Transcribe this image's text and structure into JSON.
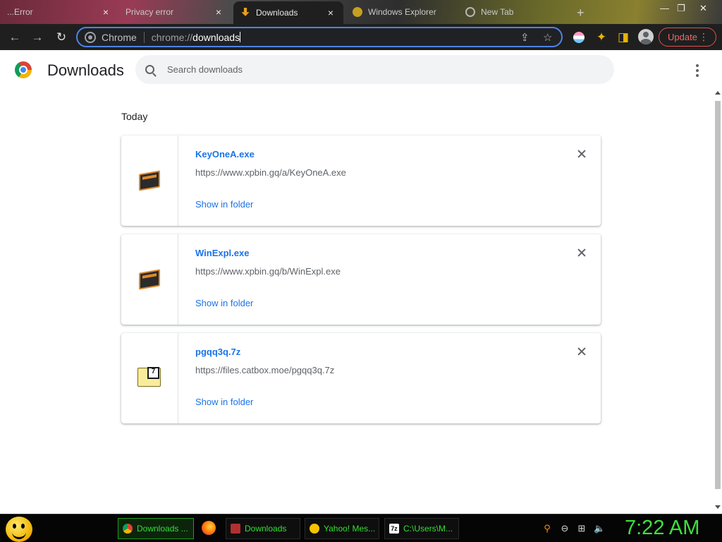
{
  "browser": {
    "tabs": [
      {
        "label": "...Error",
        "active": false
      },
      {
        "label": "Privacy error",
        "active": false
      },
      {
        "label": "Downloads",
        "active": true
      },
      {
        "label": "Windows Explorer",
        "active": false
      },
      {
        "label": "New Tab",
        "active": false
      }
    ],
    "new_tab_label": "+",
    "omnibox": {
      "chip": "Chrome",
      "url_prefix": "chrome://",
      "url_path": "downloads"
    },
    "update_label": "Update"
  },
  "page": {
    "title": "Downloads",
    "search_placeholder": "Search downloads",
    "section_label": "Today",
    "items": [
      {
        "name": "KeyOneA.exe",
        "url": "https://www.xpbin.gq/a/KeyOneA.exe",
        "action": "Show in folder",
        "icon": "exe-icon"
      },
      {
        "name": "WinExpl.exe",
        "url": "https://www.xpbin.gq/b/WinExpl.exe",
        "action": "Show in folder",
        "icon": "exe-icon"
      },
      {
        "name": "pgqq3q.7z",
        "url": "https://files.catbox.moe/pgqq3q.7z",
        "action": "Show in folder",
        "icon": "7z-archive-icon"
      }
    ]
  },
  "taskbar": {
    "buttons": [
      {
        "label": "Downloads ...",
        "active": true
      },
      {
        "label": "Downloads",
        "active": false
      },
      {
        "label": "Yahoo! Mes...",
        "active": false
      },
      {
        "label": "C:\\Users\\M...",
        "active": false
      }
    ],
    "clock": "7:22 AM"
  },
  "colors": {
    "accent": "#1a73e8",
    "update_red": "#e05050",
    "taskbar_green": "#33e033",
    "omnibox_focus": "#4d84e6"
  }
}
